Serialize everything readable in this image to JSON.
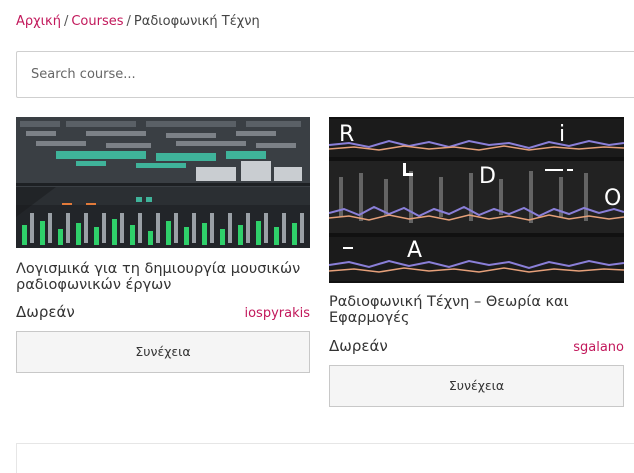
{
  "breadcrumb": {
    "home": "Αρχική",
    "courses": "Courses",
    "separator": "/",
    "current": "Ραδιοφωνική Τέχνη"
  },
  "search": {
    "placeholder": "Search course..."
  },
  "courses": [
    {
      "title": "Λογισμικά για τη δημιουργία μουσικών ραδιοφωνικών έργων",
      "price": "Δωρεάν",
      "author": "iospyrakis",
      "button": "Συνέχεια"
    },
    {
      "title": "Ραδιοφωνική Τέχνη – Θεωρία και Εφαρμογές",
      "price": "Δωρεάν",
      "author": "sgalano",
      "button": "Συνέχεια",
      "thumb_letters": [
        "R",
        "i",
        "D",
        "O",
        "A"
      ]
    }
  ],
  "colors": {
    "accent": "#c2185b",
    "text": "#333333",
    "button_bg": "#f5f5f5"
  }
}
